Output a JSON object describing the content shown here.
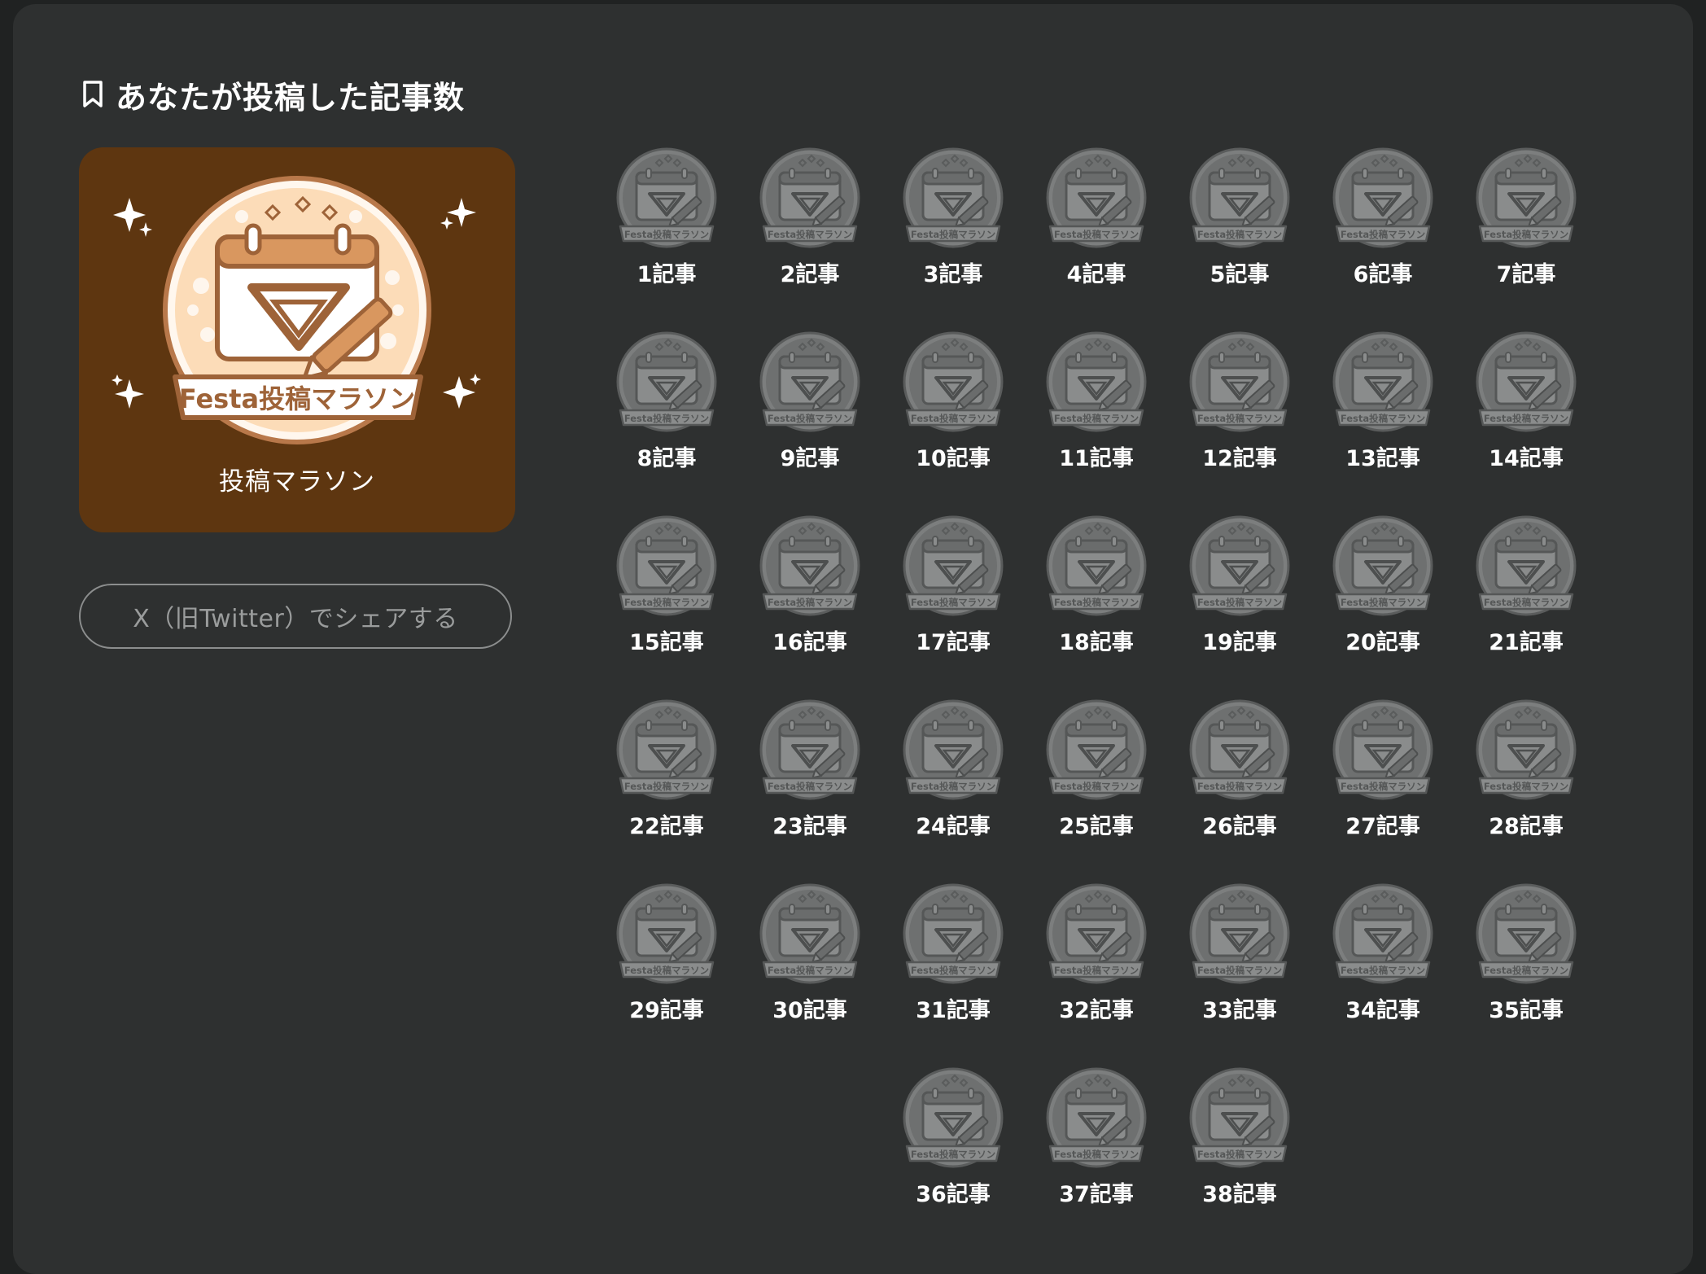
{
  "section": {
    "title": "あなたが投稿した記事数",
    "icon": "bookmark-icon"
  },
  "featured": {
    "badge_text": "Festa投稿マラソン",
    "label": "投稿マラソン",
    "colors": {
      "card": "#5e3610",
      "badge_fill": "#fce3c6",
      "badge_ring": "#b8784a"
    }
  },
  "share_button": {
    "label": "X（旧Twitter）でシェアする"
  },
  "badges": {
    "badge_text": "Festa投稿マラソン",
    "items": [
      "1記事",
      "2記事",
      "3記事",
      "4記事",
      "5記事",
      "6記事",
      "7記事",
      "8記事",
      "9記事",
      "10記事",
      "11記事",
      "12記事",
      "13記事",
      "14記事",
      "15記事",
      "16記事",
      "17記事",
      "18記事",
      "19記事",
      "20記事",
      "21記事",
      "22記事",
      "23記事",
      "24記事",
      "25記事",
      "26記事",
      "27記事",
      "28記事",
      "29記事",
      "30記事",
      "31記事",
      "32記事",
      "33記事",
      "34記事",
      "35記事",
      "36記事",
      "37記事",
      "38記事"
    ]
  }
}
